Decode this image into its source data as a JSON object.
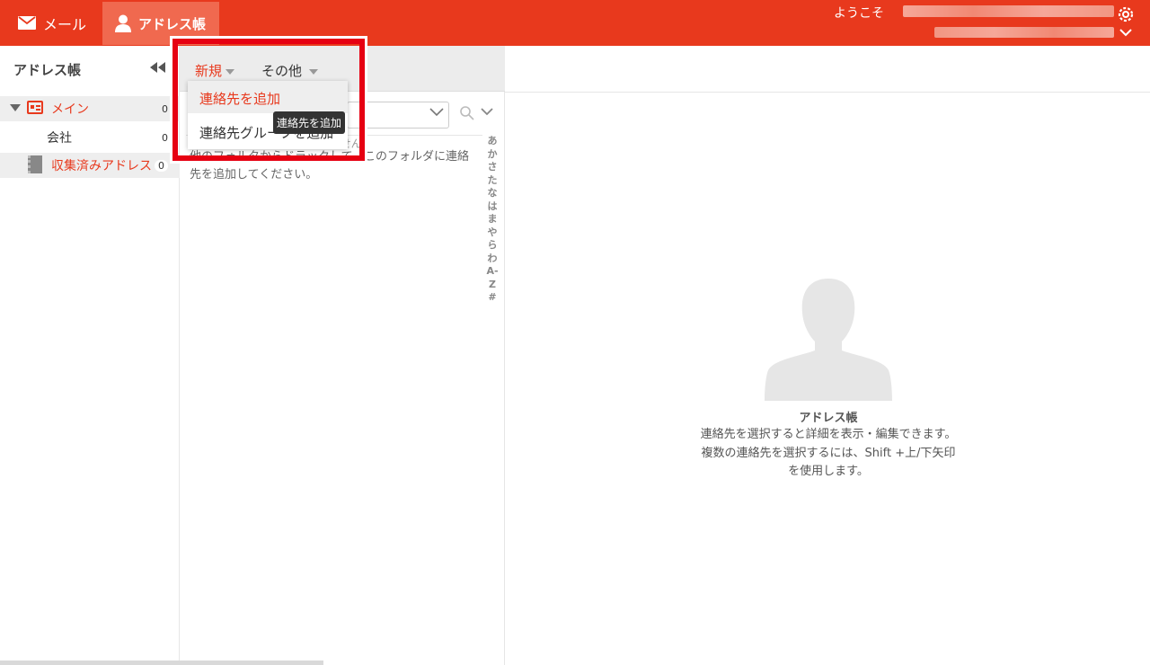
{
  "header": {
    "mail_label": "メール",
    "addressbook_label": "アドレス帳",
    "welcome": "ようこそ"
  },
  "sidebar": {
    "title": "アドレス帳",
    "items": [
      {
        "label": "メイン",
        "count": "0"
      },
      {
        "label": "会社",
        "count": "0"
      },
      {
        "label": "収集済みアドレス",
        "count": "0"
      }
    ]
  },
  "toolbar": {
    "new_label": "新規",
    "other_label": "その他"
  },
  "dropdown": {
    "items": [
      "連絡先を追加",
      "連絡先グループを追加"
    ],
    "tooltip": "連絡先を追加"
  },
  "list": {
    "empty_line1": "このフォルダに連絡先はありません。",
    "empty_line2": "他のフォルタからドラックして、このフォルダに連絡先を追加してください。",
    "index": [
      "あ",
      "か",
      "さ",
      "た",
      "な",
      "は",
      "ま",
      "や",
      "ら",
      "わ",
      "A-Z",
      "#"
    ]
  },
  "detail": {
    "title": "アドレス帳",
    "description": "連絡先を選択すると詳細を表示・編集できます。 複数の連絡先を選択するには、Shift +上/下矢印を使用します。"
  },
  "colors": {
    "brand": "#e8391d",
    "highlight": "#e60012"
  }
}
